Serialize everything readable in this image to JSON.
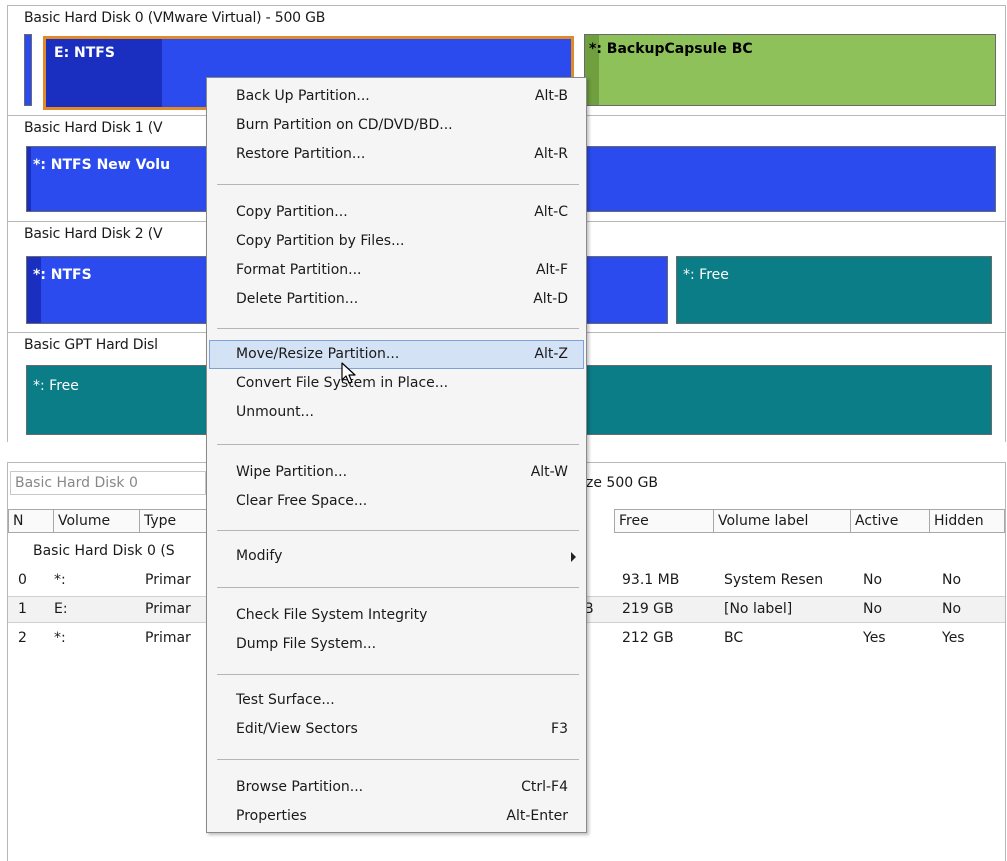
{
  "disks": [
    {
      "title": "Basic Hard Disk 0 (VMware Virtual) - 500 GB",
      "partitions": [
        {
          "label": ""
        },
        {
          "label": "E: NTFS"
        },
        {
          "label": "*: BackupCapsule BC"
        }
      ]
    },
    {
      "title": "Basic Hard Disk 1 (V",
      "partitions": [
        {
          "label": "*: NTFS New Volu"
        }
      ]
    },
    {
      "title": "Basic Hard Disk 2 (V",
      "partitions": [
        {
          "label": "*: NTFS"
        },
        {
          "label": "*: Free"
        }
      ]
    },
    {
      "title": "Basic GPT Hard Disl",
      "partitions": [
        {
          "label": "*: Free"
        }
      ]
    }
  ],
  "list": {
    "title": "Basic Hard Disk 0",
    "size_text": "ze 500 GB",
    "columns": [
      "N",
      "Volume",
      "Type",
      "Free",
      "Volume label",
      "Active",
      "Hidden"
    ],
    "group": "Basic Hard Disk 0 (S",
    "rows": [
      {
        "n": "0",
        "volume": "*:",
        "type": "Primar",
        "extra": "",
        "free": "93.1 MB",
        "label": "System Resen",
        "active": "No",
        "hidden": "No"
      },
      {
        "n": "1",
        "volume": "E:",
        "type": "Primar",
        "extra": "B",
        "free": "219 GB",
        "label": "[No label]",
        "active": "No",
        "hidden": "No"
      },
      {
        "n": "2",
        "volume": "*:",
        "type": "Primar",
        "extra": "",
        "free": "212 GB",
        "label": "BC",
        "active": "Yes",
        "hidden": "Yes"
      }
    ]
  },
  "menu": {
    "items": [
      {
        "label": "Back Up Partition...",
        "shortcut": "Alt-B"
      },
      {
        "label": "Burn Partition on CD/DVD/BD...",
        "shortcut": ""
      },
      {
        "label": "Restore Partition...",
        "shortcut": "Alt-R"
      },
      {
        "label": "Copy Partition...",
        "shortcut": "Alt-C"
      },
      {
        "label": "Copy Partition by Files...",
        "shortcut": ""
      },
      {
        "label": "Format Partition...",
        "shortcut": "Alt-F"
      },
      {
        "label": "Delete Partition...",
        "shortcut": "Alt-D"
      },
      {
        "label": "Move/Resize Partition...",
        "shortcut": "Alt-Z"
      },
      {
        "label": "Convert File System in Place...",
        "shortcut": ""
      },
      {
        "label": "Unmount...",
        "shortcut": ""
      },
      {
        "label": "Wipe Partition...",
        "shortcut": "Alt-W"
      },
      {
        "label": "Clear Free Space...",
        "shortcut": ""
      },
      {
        "label": "Modify",
        "shortcut": ""
      },
      {
        "label": "Check File System Integrity",
        "shortcut": ""
      },
      {
        "label": "Dump File System...",
        "shortcut": ""
      },
      {
        "label": "Test Surface...",
        "shortcut": ""
      },
      {
        "label": "Edit/View Sectors",
        "shortcut": "F3"
      },
      {
        "label": "Browse Partition...",
        "shortcut": "Ctrl-F4"
      },
      {
        "label": "Properties",
        "shortcut": "Alt-Enter"
      }
    ]
  },
  "colors": {
    "partition_blue": "#2b4bee",
    "partition_green": "#8fc15a",
    "partition_teal": "#0b7d87",
    "selection_orange": "#e08a2a",
    "menu_highlight": "#d4e2f6"
  },
  "icons": {
    "cursor": "mouse-pointer-icon",
    "submenu": "submenu-arrow-icon"
  }
}
